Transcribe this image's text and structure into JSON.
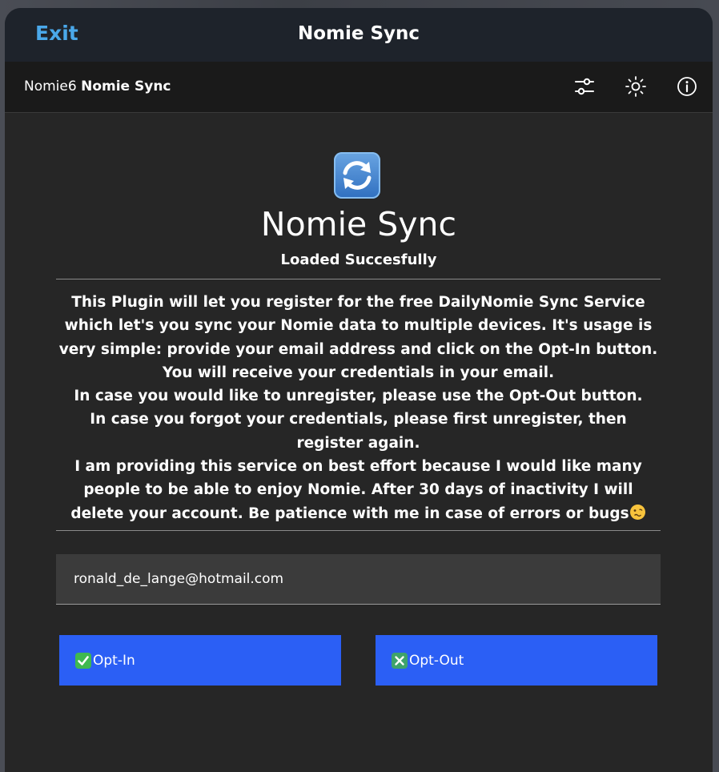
{
  "window": {
    "exit_label": "Exit",
    "title": "Nomie Sync"
  },
  "toolbar": {
    "crumb_prefix": "Nomie6",
    "crumb_current": "Nomie Sync",
    "icons": [
      "sliders-icon",
      "brightness-icon",
      "info-icon"
    ]
  },
  "plugin": {
    "icon": "sync-arrows-icon",
    "name": "Nomie Sync",
    "status": "Loaded Succesfully",
    "description": [
      "This Plugin will let you register for the free DailyNomie Sync Service which let's you sync your Nomie data to multiple devices. It's usage is very simple: provide your email address and click on the Opt-In button. You will receive your credentials in your email.",
      "In case you would like to unregister, please use the Opt-Out button.",
      "In case you forgot your credentials, please first unregister, then register again.",
      "I am providing this service on best effort because I would like many people to be able to enjoy Nomie. After 30 days of inactivity I will delete your account. Be patience with me in case of errors or bugs"
    ],
    "description_end_icon": "woozy-face-icon"
  },
  "form": {
    "email_value": "ronald_de_lange@hotmail.com",
    "opt_in_label": "Opt-In",
    "opt_out_label": "Opt-Out",
    "opt_in_icon": "check-mark-icon",
    "opt_out_icon": "cross-mark-icon"
  },
  "colors": {
    "accent": "#4aa8ea",
    "button": "#2b5ff5",
    "check": "#3fb950",
    "cross": "#3fa36b"
  }
}
